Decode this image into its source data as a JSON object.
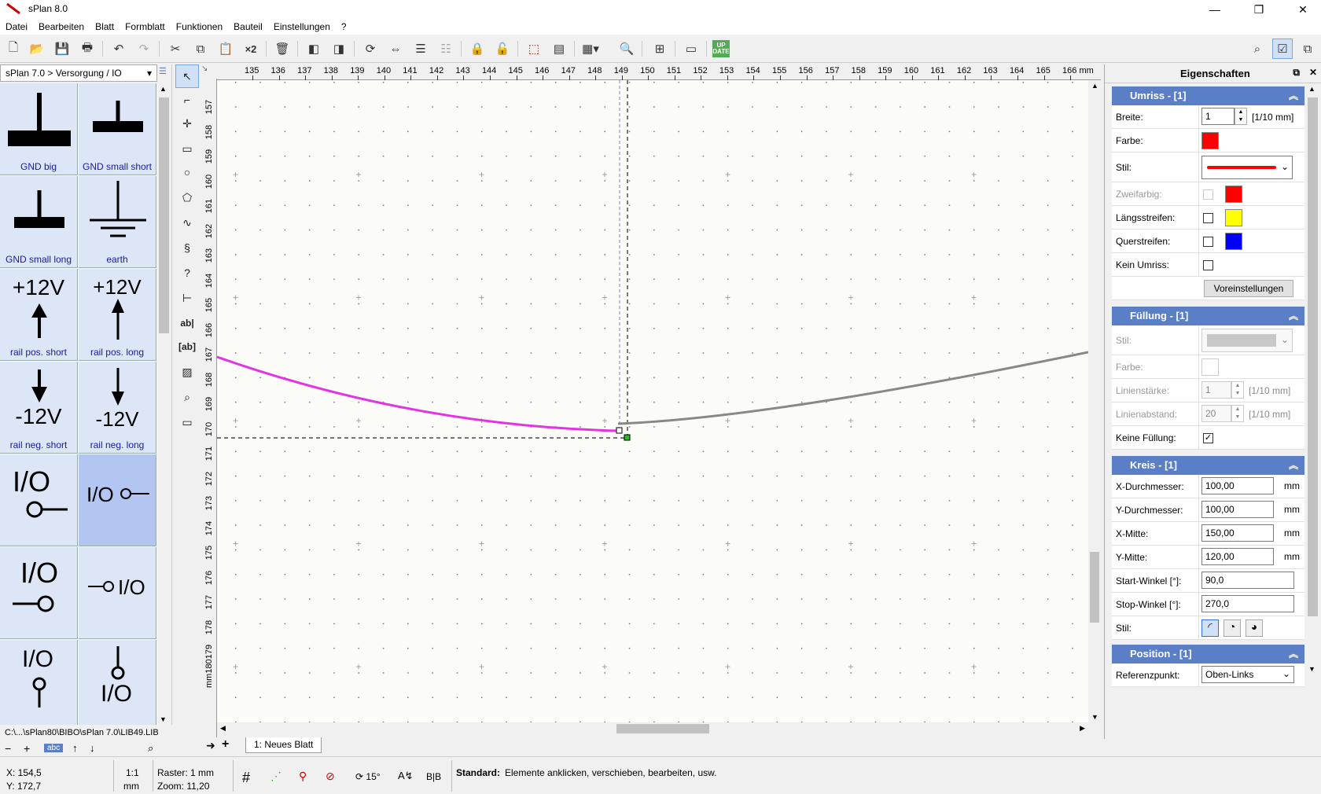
{
  "window": {
    "title": "sPlan 8.0",
    "buttons": [
      "—",
      "❐",
      "✕"
    ]
  },
  "menu": [
    "Datei",
    "Bearbeiten",
    "Blatt",
    "Formblatt",
    "Funktionen",
    "Bauteil",
    "Einstellungen",
    "?"
  ],
  "toolbar": {
    "x2_label": "×2",
    "update_label": "UP DATE"
  },
  "library": {
    "path": "sPlan 7.0 > Versorgung / IO",
    "file": "C:\\...\\sPlan80\\BIBO\\sPlan 7.0\\LIB49.LIB",
    "items": [
      {
        "label": "GND big"
      },
      {
        "label": "GND small short"
      },
      {
        "label": "GND small long"
      },
      {
        "label": "earth"
      },
      {
        "label": "rail pos. short",
        "symbol": "+12V"
      },
      {
        "label": "rail pos. long",
        "symbol": "+12V"
      },
      {
        "label": "rail neg. short",
        "symbol": "-12V"
      },
      {
        "label": "rail neg. long",
        "symbol": "-12V"
      },
      {
        "label": "",
        "symbol": "I/O"
      },
      {
        "label": "",
        "symbol": "I/O"
      },
      {
        "label": "",
        "symbol": "I/O"
      },
      {
        "label": "",
        "symbol": "I/O"
      },
      {
        "label": "",
        "symbol": "I/O"
      },
      {
        "label": "",
        "symbol": "I/O"
      }
    ],
    "footer_buttons": [
      "−",
      "+",
      "abc",
      "↑",
      "↓",
      "⌕"
    ]
  },
  "ruler": {
    "top": [
      "135",
      "136",
      "137",
      "138",
      "139",
      "140",
      "141",
      "142",
      "143",
      "144",
      "145",
      "146",
      "147",
      "148",
      "149",
      "150",
      "151",
      "152",
      "153",
      "154",
      "155",
      "156",
      "157",
      "158",
      "159",
      "160",
      "161",
      "162",
      "163",
      "164",
      "165",
      "166 mm"
    ],
    "left": [
      "157",
      "158",
      "159",
      "160",
      "161",
      "162",
      "163",
      "164",
      "165",
      "166",
      "167",
      "168",
      "169",
      "170",
      "171",
      "172",
      "173",
      "174",
      "175",
      "176",
      "177",
      "178",
      "179",
      "mm180"
    ]
  },
  "tabs": {
    "sheet": "1: Neues Blatt"
  },
  "properties": {
    "header": "Eigenschaften",
    "umriss": {
      "title": "Umriss - [1]",
      "breite_label": "Breite:",
      "breite_value": "1",
      "breite_unit": "[1/10 mm]",
      "farbe_label": "Farbe:",
      "farbe_color": "#ff0000",
      "stil_label": "Stil:",
      "stil_color": "#ff0000",
      "zweifarbig_label": "Zweifarbig:",
      "zweifarbig_color": "#ff0000",
      "laengs_label": "Längsstreifen:",
      "laengs_color": "#ffff00",
      "quer_label": "Querstreifen:",
      "quer_color": "#0000ff",
      "kein_label": "Kein Umriss:",
      "voreinstellungen": "Voreinstellungen"
    },
    "fuellung": {
      "title": "Füllung  - [1]",
      "stil_label": "Stil:",
      "farbe_label": "Farbe:",
      "linienstaerke_label": "Linienstärke:",
      "linienstaerke_value": "1",
      "linienstaerke_unit": "[1/10 mm]",
      "linienabstand_label": "Linienabstand:",
      "linienabstand_value": "20",
      "linienabstand_unit": "[1/10 mm]",
      "keine_label": "Keine Füllung:",
      "keine_checked": "✓"
    },
    "kreis": {
      "title": "Kreis  - [1]",
      "xd_label": "X-Durchmesser:",
      "xd_value": "100,00",
      "yd_label": "Y-Durchmesser:",
      "yd_value": "100,00",
      "xm_label": "X-Mitte:",
      "xm_value": "150,00",
      "ym_label": "Y-Mitte:",
      "ym_value": "120,00",
      "unit": "mm",
      "start_label": "Start-Winkel [°]:",
      "start_value": "90,0",
      "stop_label": "Stop-Winkel [°]:",
      "stop_value": "270,0",
      "stil_label": "Stil:"
    },
    "position": {
      "title": "Position  - [1]",
      "ref_label": "Referenzpunkt:",
      "ref_value": "Oben-Links"
    }
  },
  "status": {
    "x": "X:   154,5",
    "y": "Y:   172,7",
    "scale": "1:1",
    "scale_unit": "mm",
    "raster": "Raster: 1 mm",
    "zoom": "Zoom: 11,20",
    "angle": "15°",
    "hint_bold": "Standard:",
    "hint": "Elemente anklicken, verschieben, bearbeiten, usw."
  }
}
